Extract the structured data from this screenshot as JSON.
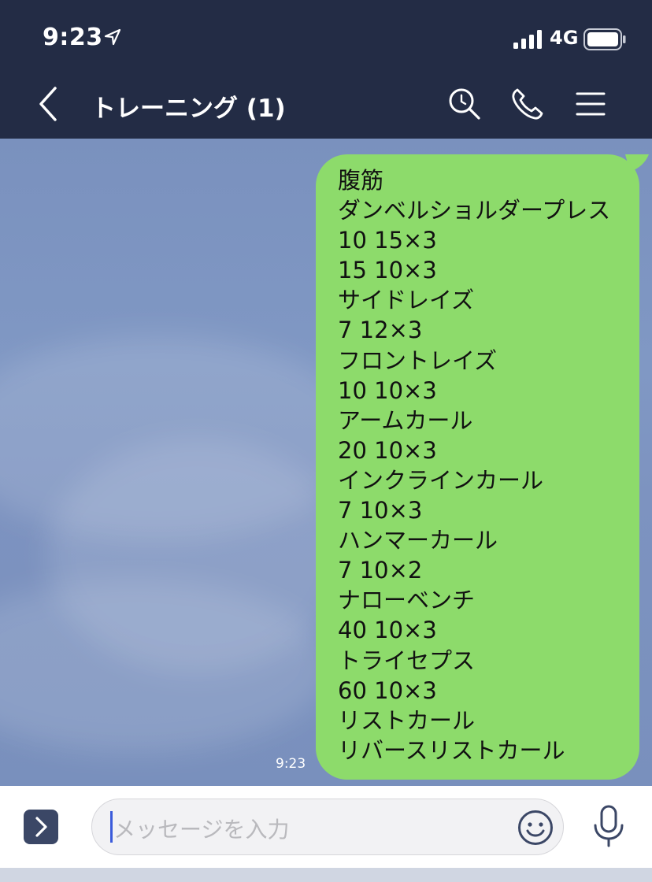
{
  "status_bar": {
    "time": "9:23",
    "network": "4G"
  },
  "header": {
    "title": "トレーニング (1)"
  },
  "message": {
    "lines": [
      "腹筋",
      "ダンベルショルダープレス",
      "10 15×3",
      "15 10×3",
      "サイドレイズ",
      "7 12×3",
      "フロントレイズ",
      "10 10×3",
      "アームカール",
      "20 10×3",
      "インクラインカール",
      "7 10×3",
      "ハンマーカール",
      "7 10×2",
      "ナローベンチ",
      "40 10×3",
      "トライセプス",
      "60 10×3",
      "リストカール",
      "リバースリストカール"
    ],
    "time": "9:23"
  },
  "input": {
    "placeholder": "メッセージを入力"
  },
  "icons": {
    "location": "location-arrow-icon",
    "signal": "signal-bars-icon",
    "battery": "battery-icon",
    "back": "chevron-left-icon",
    "search": "search-icon",
    "call": "phone-icon",
    "menu": "hamburger-menu-icon",
    "expand": "chevron-right-icon",
    "emoji": "smiley-icon",
    "mic": "microphone-icon"
  },
  "colors": {
    "header_bg": "#232c45",
    "bubble": "#8ddb6b",
    "chat_bg": "#7b92c0",
    "caret": "#3b5bdb"
  }
}
